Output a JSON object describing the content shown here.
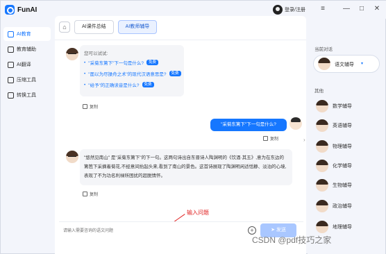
{
  "app": {
    "name": "FunAI"
  },
  "titlebar": {
    "login_label": "登录/注册"
  },
  "sidebar": {
    "items": [
      {
        "label": "AI教育",
        "active": true
      },
      {
        "label": "教育辅助"
      },
      {
        "label": "AI翻译"
      },
      {
        "label": "压缩工具"
      },
      {
        "label": "转换工具"
      }
    ]
  },
  "tabs": [
    {
      "label": "AI课件总结"
    },
    {
      "label": "AI教师辅导",
      "active": true
    }
  ],
  "chat": {
    "try_title": "您可以试试:",
    "suggestions": [
      {
        "text": "\"采菊东篱下\"下一句是什么?",
        "badge": "免费"
      },
      {
        "text": "\"面以为尽操舟之术\"的现代汉语意思是?",
        "badge": "免费"
      },
      {
        "text": "\"给予\"的正确读音是什么?",
        "badge": "免费"
      }
    ],
    "copy_label": "复制",
    "user_message": "\"采菊东篱下\"下一句是什么?",
    "answer": "\"悠然见南山\" 是\"采菊东篱下\"的下一句。这两句诗出自东晋诗人陶渊明的《饮酒·其五》,意为在东边的篱笆下采摘着菊花,不经意间抬起头来,看到了南山的景色。这首诗展现了陶渊明闲适恬静、淡泊的心境,表现了不为功名利禄所困扰的超脱情怀。"
  },
  "annotation": {
    "text": "输入问题"
  },
  "input": {
    "placeholder": "请输入需要咨询的语文问题",
    "send_label": "发送"
  },
  "right_panel": {
    "current_title": "当前对话",
    "current_tutor": "语文辅导",
    "others_title": "其他",
    "tutors": [
      "数学辅导",
      "英语辅导",
      "物理辅导",
      "化学辅导",
      "生物辅导",
      "政治辅导",
      "地理辅导"
    ]
  },
  "watermark": "CSDN @pdf技巧之家"
}
